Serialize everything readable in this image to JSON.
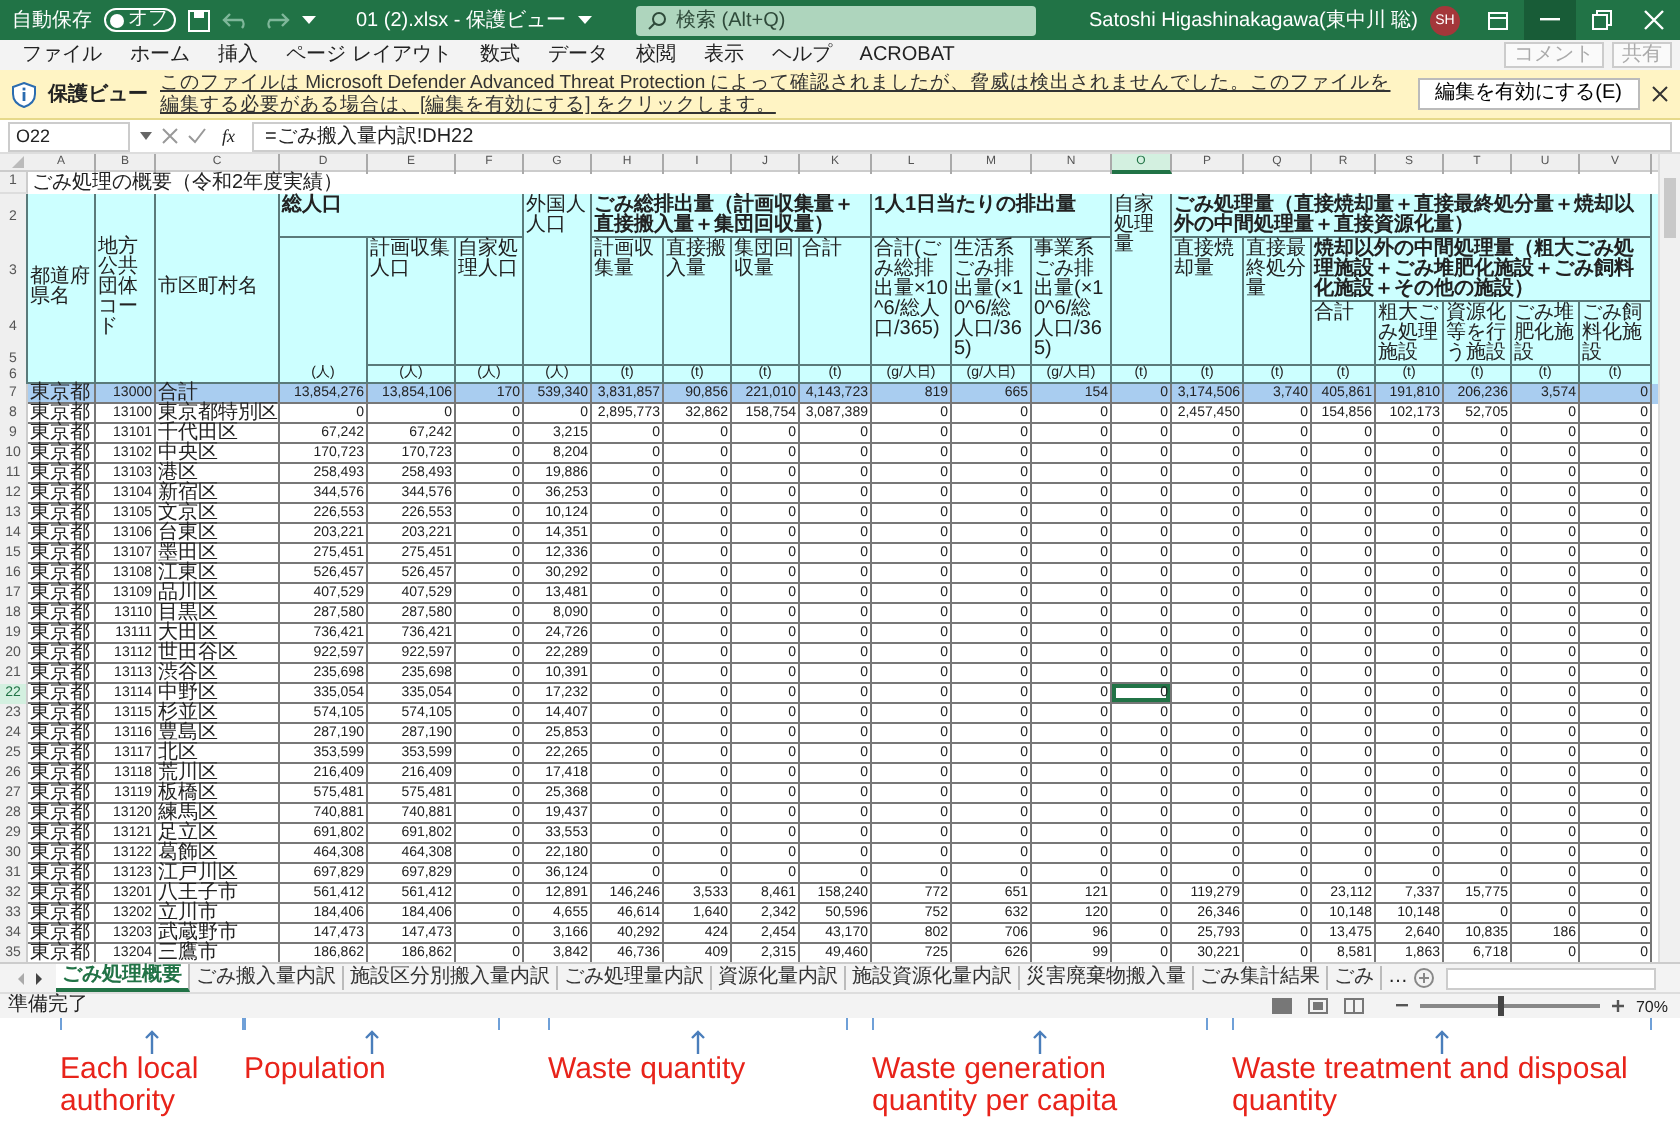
{
  "title_bar": {
    "autosave_label": "自動保存",
    "autosave_state": "オフ",
    "autosave_on": false,
    "file_title": "01 (2).xlsx - 保護ビュー",
    "search_placeholder": "検索 (Alt+Q)",
    "user_name": "Satoshi Higashinakagawa(東中川 聡)",
    "avatar_initials": "SH"
  },
  "menu": [
    "ファイル",
    "ホーム",
    "挿入",
    "ページ レイアウト",
    "数式",
    "データ",
    "校閲",
    "表示",
    "ヘルプ",
    "ACROBAT"
  ],
  "menu_buttons": [
    {
      "label": "コメント",
      "disabled": true
    },
    {
      "label": "共有",
      "disabled": true
    }
  ],
  "protected_view": {
    "label": "保護ビュー",
    "message": "このファイルは Microsoft Defender Advanced Threat Protection によって確認されましたが、脅威は検出されませんでした。このファイルを編集する必要がある場合は、[編集を有効にする] をクリックします。",
    "button": "編集を有効にする(E)"
  },
  "formula_bar": {
    "name_box": "O22",
    "function_label": "fx",
    "formula": "=ごみ搬入量内訳!DH22"
  },
  "sheet": {
    "columns": [
      {
        "letter": "A",
        "selected": false
      },
      {
        "letter": "B",
        "selected": false
      },
      {
        "letter": "C",
        "selected": false
      },
      {
        "letter": "D",
        "selected": false
      },
      {
        "letter": "E",
        "selected": false
      },
      {
        "letter": "F",
        "selected": false
      },
      {
        "letter": "G",
        "selected": false
      },
      {
        "letter": "H",
        "selected": false
      },
      {
        "letter": "I",
        "selected": false
      },
      {
        "letter": "J",
        "selected": false
      },
      {
        "letter": "K",
        "selected": false
      },
      {
        "letter": "L",
        "selected": false
      },
      {
        "letter": "M",
        "selected": false
      },
      {
        "letter": "N",
        "selected": false
      },
      {
        "letter": "O",
        "selected": true
      },
      {
        "letter": "P",
        "selected": false
      },
      {
        "letter": "Q",
        "selected": false
      },
      {
        "letter": "R",
        "selected": false
      },
      {
        "letter": "S",
        "selected": false
      },
      {
        "letter": "T",
        "selected": false
      },
      {
        "letter": "U",
        "selected": false
      },
      {
        "letter": "V",
        "selected": false
      }
    ],
    "title_row_number": "1",
    "title": "ごみ処理の概要（令和2年度実績）",
    "header_row_numbers": [
      "2",
      "3",
      "4",
      "5",
      "6"
    ],
    "headers": [
      "都道府県名",
      "地方公共団体コード",
      "市区町村名",
      "総人口",
      "計画収集人口",
      "自家処理人口",
      "外国人人口",
      "ごみ総排出量（計画収集量＋直接搬入量＋集団回収量）",
      "計画収集量",
      "直接搬入量",
      "集団回収量",
      "合計",
      "1人1日当たりの排出量",
      "合計(ごみ総排出量×10^6/総人口/365)",
      "生活系ごみ排出量(×10^6/総人口/365)",
      "事業系ごみ排出量(×10^6/総人口/365)",
      "自家処理量",
      "ごみ処理量（直接焼却量＋直接最終処分量＋焼却以外の中間処理量＋直接資源化量）",
      "直接焼却量",
      "直接最終処分量",
      "焼却以外の中間処理量（粗大ごみ処理施設＋ごみ堆肥化施設＋ごみ飼料化施設＋その他の施設）",
      "合計",
      "粗大ごみ処理施設",
      "資源化等を行う施設",
      "ごみ堆肥化施設",
      "ごみ飼料化施設"
    ],
    "units": [
      "(人)",
      "(人)",
      "(人)",
      "(人)",
      "(t)",
      "(t)",
      "(t)",
      "(t)",
      "(g/人日)",
      "(g/人日)",
      "(g/人日)",
      "(t)",
      "(t)",
      "(t)",
      "(t)",
      "(t)",
      "(t)",
      "(t)",
      "(t)"
    ],
    "rows": [
      {
        "num": "7",
        "highlighted": true,
        "selected": false,
        "cells": [
          "東京都",
          "13000",
          "合計",
          "13,854,276",
          "13,854,106",
          "170",
          "539,340",
          "3,831,857",
          "90,856",
          "221,010",
          "4,143,723",
          "819",
          "665",
          "154",
          "0",
          "3,174,506",
          "3,740",
          "405,861",
          "191,810",
          "206,236",
          "3,574",
          "0"
        ]
      },
      {
        "num": "8",
        "highlighted": false,
        "selected": false,
        "cells": [
          "東京都",
          "13100",
          "東京都特別区",
          "0",
          "0",
          "0",
          "0",
          "2,895,773",
          "32,862",
          "158,754",
          "3,087,389",
          "0",
          "0",
          "0",
          "0",
          "2,457,450",
          "0",
          "154,856",
          "102,173",
          "52,705",
          "0",
          "0"
        ]
      },
      {
        "num": "9",
        "highlighted": false,
        "selected": false,
        "cells": [
          "東京都",
          "13101",
          "千代田区",
          "67,242",
          "67,242",
          "0",
          "3,215",
          "0",
          "0",
          "0",
          "0",
          "0",
          "0",
          "0",
          "0",
          "0",
          "0",
          "0",
          "0",
          "0",
          "0",
          "0"
        ]
      },
      {
        "num": "10",
        "highlighted": false,
        "selected": false,
        "cells": [
          "東京都",
          "13102",
          "中央区",
          "170,723",
          "170,723",
          "0",
          "8,204",
          "0",
          "0",
          "0",
          "0",
          "0",
          "0",
          "0",
          "0",
          "0",
          "0",
          "0",
          "0",
          "0",
          "0",
          "0"
        ]
      },
      {
        "num": "11",
        "highlighted": false,
        "selected": false,
        "cells": [
          "東京都",
          "13103",
          "港区",
          "258,493",
          "258,493",
          "0",
          "19,886",
          "0",
          "0",
          "0",
          "0",
          "0",
          "0",
          "0",
          "0",
          "0",
          "0",
          "0",
          "0",
          "0",
          "0",
          "0"
        ]
      },
      {
        "num": "12",
        "highlighted": false,
        "selected": false,
        "cells": [
          "東京都",
          "13104",
          "新宿区",
          "344,576",
          "344,576",
          "0",
          "36,253",
          "0",
          "0",
          "0",
          "0",
          "0",
          "0",
          "0",
          "0",
          "0",
          "0",
          "0",
          "0",
          "0",
          "0",
          "0"
        ]
      },
      {
        "num": "13",
        "highlighted": false,
        "selected": false,
        "cells": [
          "東京都",
          "13105",
          "文京区",
          "226,553",
          "226,553",
          "0",
          "10,124",
          "0",
          "0",
          "0",
          "0",
          "0",
          "0",
          "0",
          "0",
          "0",
          "0",
          "0",
          "0",
          "0",
          "0",
          "0"
        ]
      },
      {
        "num": "14",
        "highlighted": false,
        "selected": false,
        "cells": [
          "東京都",
          "13106",
          "台東区",
          "203,221",
          "203,221",
          "0",
          "14,351",
          "0",
          "0",
          "0",
          "0",
          "0",
          "0",
          "0",
          "0",
          "0",
          "0",
          "0",
          "0",
          "0",
          "0",
          "0"
        ]
      },
      {
        "num": "15",
        "highlighted": false,
        "selected": false,
        "cells": [
          "東京都",
          "13107",
          "墨田区",
          "275,451",
          "275,451",
          "0",
          "12,336",
          "0",
          "0",
          "0",
          "0",
          "0",
          "0",
          "0",
          "0",
          "0",
          "0",
          "0",
          "0",
          "0",
          "0",
          "0"
        ]
      },
      {
        "num": "16",
        "highlighted": false,
        "selected": false,
        "cells": [
          "東京都",
          "13108",
          "江東区",
          "526,457",
          "526,457",
          "0",
          "30,292",
          "0",
          "0",
          "0",
          "0",
          "0",
          "0",
          "0",
          "0",
          "0",
          "0",
          "0",
          "0",
          "0",
          "0",
          "0"
        ]
      },
      {
        "num": "17",
        "highlighted": false,
        "selected": false,
        "cells": [
          "東京都",
          "13109",
          "品川区",
          "407,529",
          "407,529",
          "0",
          "13,481",
          "0",
          "0",
          "0",
          "0",
          "0",
          "0",
          "0",
          "0",
          "0",
          "0",
          "0",
          "0",
          "0",
          "0",
          "0"
        ]
      },
      {
        "num": "18",
        "highlighted": false,
        "selected": false,
        "cells": [
          "東京都",
          "13110",
          "目黒区",
          "287,580",
          "287,580",
          "0",
          "8,090",
          "0",
          "0",
          "0",
          "0",
          "0",
          "0",
          "0",
          "0",
          "0",
          "0",
          "0",
          "0",
          "0",
          "0",
          "0"
        ]
      },
      {
        "num": "19",
        "highlighted": false,
        "selected": false,
        "cells": [
          "東京都",
          "13111",
          "大田区",
          "736,421",
          "736,421",
          "0",
          "24,726",
          "0",
          "0",
          "0",
          "0",
          "0",
          "0",
          "0",
          "0",
          "0",
          "0",
          "0",
          "0",
          "0",
          "0",
          "0"
        ]
      },
      {
        "num": "20",
        "highlighted": false,
        "selected": false,
        "cells": [
          "東京都",
          "13112",
          "世田谷区",
          "922,597",
          "922,597",
          "0",
          "22,289",
          "0",
          "0",
          "0",
          "0",
          "0",
          "0",
          "0",
          "0",
          "0",
          "0",
          "0",
          "0",
          "0",
          "0",
          "0"
        ]
      },
      {
        "num": "21",
        "highlighted": false,
        "selected": false,
        "cells": [
          "東京都",
          "13113",
          "渋谷区",
          "235,698",
          "235,698",
          "0",
          "10,391",
          "0",
          "0",
          "0",
          "0",
          "0",
          "0",
          "0",
          "0",
          "0",
          "0",
          "0",
          "0",
          "0",
          "0",
          "0"
        ]
      },
      {
        "num": "22",
        "highlighted": false,
        "selected": true,
        "cells": [
          "東京都",
          "13114",
          "中野区",
          "335,054",
          "335,054",
          "0",
          "17,232",
          "0",
          "0",
          "0",
          "0",
          "0",
          "0",
          "0",
          "0",
          "0",
          "0",
          "0",
          "0",
          "0",
          "0",
          "0"
        ]
      },
      {
        "num": "23",
        "highlighted": false,
        "selected": false,
        "cells": [
          "東京都",
          "13115",
          "杉並区",
          "574,105",
          "574,105",
          "0",
          "14,407",
          "0",
          "0",
          "0",
          "0",
          "0",
          "0",
          "0",
          "0",
          "0",
          "0",
          "0",
          "0",
          "0",
          "0",
          "0"
        ]
      },
      {
        "num": "24",
        "highlighted": false,
        "selected": false,
        "cells": [
          "東京都",
          "13116",
          "豊島区",
          "287,190",
          "287,190",
          "0",
          "25,853",
          "0",
          "0",
          "0",
          "0",
          "0",
          "0",
          "0",
          "0",
          "0",
          "0",
          "0",
          "0",
          "0",
          "0",
          "0"
        ]
      },
      {
        "num": "25",
        "highlighted": false,
        "selected": false,
        "cells": [
          "東京都",
          "13117",
          "北区",
          "353,599",
          "353,599",
          "0",
          "22,265",
          "0",
          "0",
          "0",
          "0",
          "0",
          "0",
          "0",
          "0",
          "0",
          "0",
          "0",
          "0",
          "0",
          "0",
          "0"
        ]
      },
      {
        "num": "26",
        "highlighted": false,
        "selected": false,
        "cells": [
          "東京都",
          "13118",
          "荒川区",
          "216,409",
          "216,409",
          "0",
          "17,418",
          "0",
          "0",
          "0",
          "0",
          "0",
          "0",
          "0",
          "0",
          "0",
          "0",
          "0",
          "0",
          "0",
          "0",
          "0"
        ]
      },
      {
        "num": "27",
        "highlighted": false,
        "selected": false,
        "cells": [
          "東京都",
          "13119",
          "板橋区",
          "575,481",
          "575,481",
          "0",
          "25,368",
          "0",
          "0",
          "0",
          "0",
          "0",
          "0",
          "0",
          "0",
          "0",
          "0",
          "0",
          "0",
          "0",
          "0",
          "0"
        ]
      },
      {
        "num": "28",
        "highlighted": false,
        "selected": false,
        "cells": [
          "東京都",
          "13120",
          "練馬区",
          "740,881",
          "740,881",
          "0",
          "19,437",
          "0",
          "0",
          "0",
          "0",
          "0",
          "0",
          "0",
          "0",
          "0",
          "0",
          "0",
          "0",
          "0",
          "0",
          "0"
        ]
      },
      {
        "num": "29",
        "highlighted": false,
        "selected": false,
        "cells": [
          "東京都",
          "13121",
          "足立区",
          "691,802",
          "691,802",
          "0",
          "33,553",
          "0",
          "0",
          "0",
          "0",
          "0",
          "0",
          "0",
          "0",
          "0",
          "0",
          "0",
          "0",
          "0",
          "0",
          "0"
        ]
      },
      {
        "num": "30",
        "highlighted": false,
        "selected": false,
        "cells": [
          "東京都",
          "13122",
          "葛飾区",
          "464,308",
          "464,308",
          "0",
          "22,180",
          "0",
          "0",
          "0",
          "0",
          "0",
          "0",
          "0",
          "0",
          "0",
          "0",
          "0",
          "0",
          "0",
          "0",
          "0"
        ]
      },
      {
        "num": "31",
        "highlighted": false,
        "selected": false,
        "cells": [
          "東京都",
          "13123",
          "江戸川区",
          "697,829",
          "697,829",
          "0",
          "36,124",
          "0",
          "0",
          "0",
          "0",
          "0",
          "0",
          "0",
          "0",
          "0",
          "0",
          "0",
          "0",
          "0",
          "0",
          "0"
        ]
      },
      {
        "num": "32",
        "highlighted": false,
        "selected": false,
        "cells": [
          "東京都",
          "13201",
          "八王子市",
          "561,412",
          "561,412",
          "0",
          "12,891",
          "146,246",
          "3,533",
          "8,461",
          "158,240",
          "772",
          "651",
          "121",
          "0",
          "119,279",
          "0",
          "23,112",
          "7,337",
          "15,775",
          "0",
          "0"
        ]
      },
      {
        "num": "33",
        "highlighted": false,
        "selected": false,
        "cells": [
          "東京都",
          "13202",
          "立川市",
          "184,406",
          "184,406",
          "0",
          "4,655",
          "46,614",
          "1,640",
          "2,342",
          "50,596",
          "752",
          "632",
          "120",
          "0",
          "26,346",
          "0",
          "10,148",
          "10,148",
          "0",
          "0",
          "0"
        ]
      },
      {
        "num": "34",
        "highlighted": false,
        "selected": false,
        "cells": [
          "東京都",
          "13203",
          "武蔵野市",
          "147,473",
          "147,473",
          "0",
          "3,166",
          "40,292",
          "424",
          "2,454",
          "43,170",
          "802",
          "706",
          "96",
          "0",
          "25,793",
          "0",
          "13,475",
          "2,640",
          "10,835",
          "186",
          "0"
        ]
      },
      {
        "num": "35",
        "highlighted": false,
        "selected": false,
        "cells": [
          "東京都",
          "13204",
          "三鷹市",
          "186,862",
          "186,862",
          "0",
          "3,842",
          "46,736",
          "409",
          "2,315",
          "49,460",
          "725",
          "626",
          "99",
          "0",
          "30,221",
          "0",
          "8,581",
          "1,863",
          "6,718",
          "0",
          "0"
        ]
      }
    ]
  },
  "sheet_tabs": [
    {
      "label": "ごみ処理概要",
      "selected": true
    },
    {
      "label": "ごみ搬入量内訳",
      "selected": false
    },
    {
      "label": "施設区分別搬入量内訳",
      "selected": false
    },
    {
      "label": "ごみ処理量内訳",
      "selected": false
    },
    {
      "label": "資源化量内訳",
      "selected": false
    },
    {
      "label": "施設資源化量内訳",
      "selected": false
    },
    {
      "label": "災害廃棄物搬入量",
      "selected": false
    },
    {
      "label": "ごみ集計結果",
      "selected": false
    },
    {
      "label": "ごみ",
      "selected": false
    }
  ],
  "more_tabs": "…",
  "status_bar": {
    "text": "準備完了",
    "level": 0.45,
    "zoom": "70%"
  },
  "annotations": [
    "Each local authority",
    "Population",
    "Waste quantity",
    "Waste generation quantity per capita",
    "Waste treatment  and disposal quantity"
  ]
}
